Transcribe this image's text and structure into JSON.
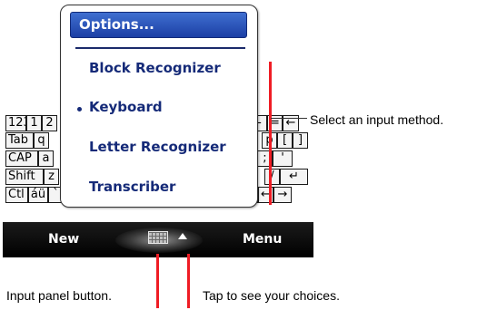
{
  "keyboard": {
    "row1": [
      "123",
      "1",
      "2",
      "-",
      "=",
      "←"
    ],
    "row2": [
      "Tab",
      "q",
      "p",
      "[",
      "]"
    ],
    "row3": [
      "CAP",
      "a",
      ";",
      "'"
    ],
    "row4": [
      "Shift",
      "z",
      "/",
      "↵"
    ],
    "row5": [
      "Ctl",
      "áü",
      "`",
      "\\",
      "↓",
      "↑",
      "←",
      "→"
    ]
  },
  "menubar": {
    "left_softkey": "New",
    "right_softkey": "Menu",
    "input_button_icon": "keyboard-icon",
    "arrow_icon": "up-arrow-icon"
  },
  "popup": {
    "title": "Options...",
    "items": [
      {
        "label": "Block Recognizer",
        "selected": false
      },
      {
        "label": "Keyboard",
        "selected": true
      },
      {
        "label": "Letter Recognizer",
        "selected": false
      },
      {
        "label": "Transcriber",
        "selected": false
      }
    ]
  },
  "annotations": {
    "select_method": "Select an input method.",
    "input_panel": "Input panel button.",
    "tap_choices": "Tap to see your choices."
  },
  "colors": {
    "accent_red": "#ef1c24",
    "menu_text": "#152a78",
    "title_bar": "#2a52be"
  }
}
